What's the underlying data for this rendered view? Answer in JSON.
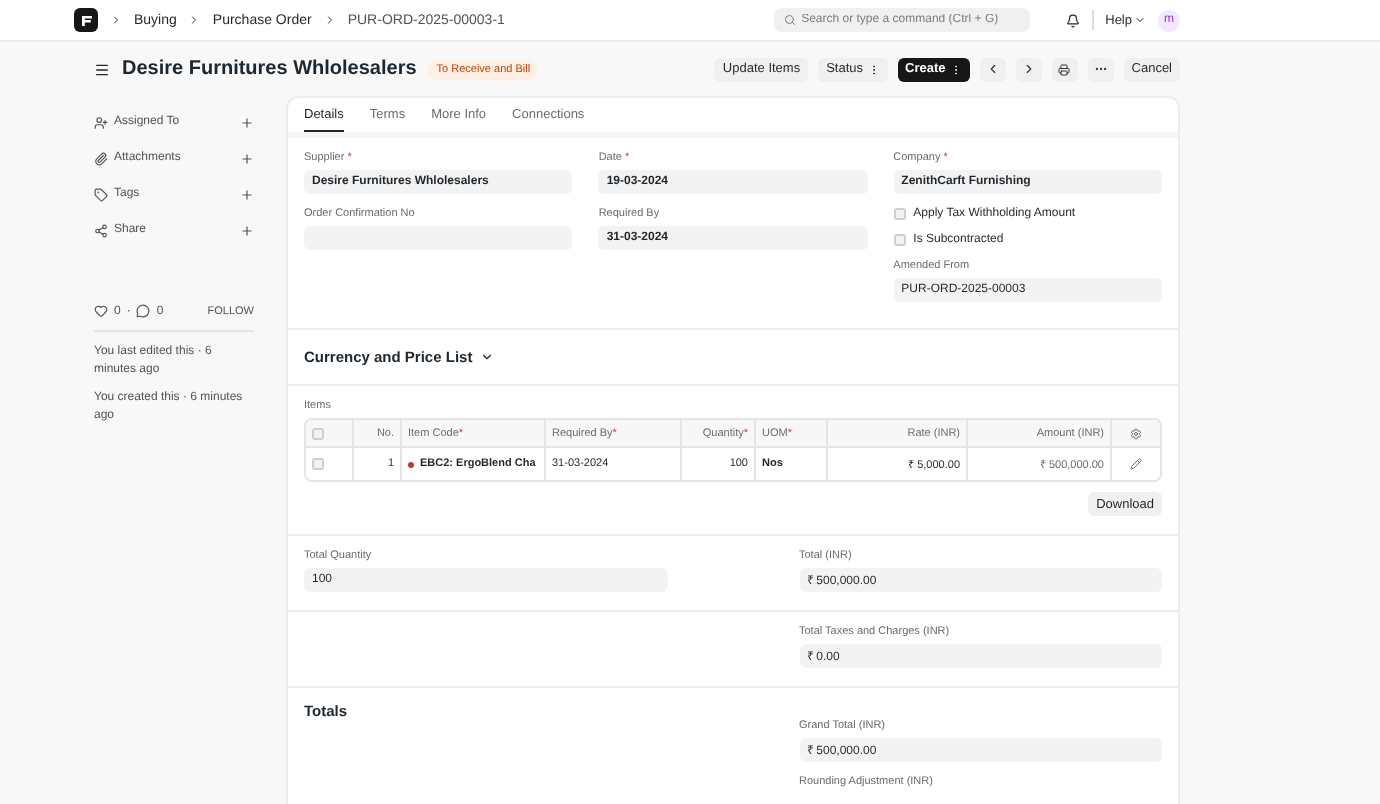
{
  "topbar": {
    "breadcrumbs": [
      "Buying",
      "Purchase Order",
      "PUR-ORD-2025-00003-1"
    ],
    "search": {
      "placeholder": "Search or type a command (Ctrl + G)"
    },
    "help": "Help",
    "avatar": "m"
  },
  "header": {
    "title": "Desire Furnitures Whlolesalers",
    "status": "To Receive and Bill",
    "actions": [
      {
        "label": "Update Items",
        "kind": "plain"
      },
      {
        "label": "Status",
        "kind": "dropdown"
      },
      {
        "label": "Create",
        "kind": "primary"
      }
    ],
    "cancel": "Cancel"
  },
  "sidebar": {
    "items": [
      {
        "label": "Assigned To",
        "kind": "assign"
      },
      {
        "label": "Attachments",
        "kind": "attach"
      },
      {
        "label": "Tags",
        "kind": "tag"
      },
      {
        "label": "Share",
        "kind": "share"
      }
    ],
    "likes": "0",
    "separator": "·",
    "comments": "0",
    "follow": "FOLLOW",
    "activity": [
      "You last edited this · 6 minutes ago",
      "You created this · 6 minutes ago"
    ]
  },
  "tabs": [
    {
      "label": "Details",
      "selected": true
    },
    {
      "label": "Terms",
      "selected": false
    },
    {
      "label": "More Info",
      "selected": false
    },
    {
      "label": "Connections",
      "selected": false
    }
  ],
  "details": {
    "columns": [
      [
        {
          "kind": "input",
          "label": "Supplier",
          "required_mark": "*",
          "value": "Desire Furnitures Whlolesalers"
        },
        {
          "kind": "input",
          "label": "Order Confirmation No"
        }
      ],
      [
        {
          "kind": "input",
          "label": "Date",
          "required_mark": "*",
          "value": "19-03-2024"
        },
        {
          "kind": "input",
          "label": "Required By",
          "value": "31-03-2024"
        }
      ],
      [
        {
          "kind": "input",
          "label": "Company",
          "required_mark": "*",
          "value": "ZenithCarft Furnishing"
        },
        {
          "kind": "checkbox",
          "label": "Apply Tax Withholding Amount",
          "checked": false
        },
        {
          "kind": "checkbox",
          "label": "Is Subcontracted",
          "checked": false
        },
        {
          "kind": "plain-input",
          "label": "Amended From",
          "value": "PUR-ORD-2025-00003"
        }
      ]
    ]
  },
  "currency_section": {
    "title": "Currency and Price List",
    "expanded": false
  },
  "items": {
    "label": "Items",
    "select_all_checked": false,
    "columns": [
      {
        "label": "No."
      },
      {
        "label": "Item Code",
        "required_mark": "*"
      },
      {
        "label": "Required By",
        "required_mark": "*"
      },
      {
        "label": "Quantity",
        "required_mark": "*"
      },
      {
        "label": "UOM",
        "required_mark": "*"
      },
      {
        "label": "Rate (INR)"
      },
      {
        "label": "Amount (INR)"
      }
    ],
    "rows": [
      {
        "checked": false,
        "no": "1",
        "item_code": "EBC2: ErgoBlend Cha",
        "color": "#c0392b",
        "required_by": "31-03-2024",
        "quantity": "100",
        "uom": "Nos",
        "rate": "₹ 5,000.00",
        "amount": "₹ 500,000.00"
      }
    ],
    "download": "Download"
  },
  "quantity_totals": {
    "left": {
      "label": "Total Quantity",
      "value": "100"
    },
    "right": {
      "label": "Total (INR)",
      "value": "₹ 500,000.00"
    }
  },
  "taxes": {
    "label": "Total Taxes and Charges (INR)",
    "value": "₹ 0.00"
  },
  "totals": {
    "title": "Totals",
    "fields": [
      {
        "label": "Grand Total (INR)",
        "value": "₹ 500,000.00"
      },
      {
        "label": "Rounding Adjustment (INR)"
      }
    ]
  }
}
